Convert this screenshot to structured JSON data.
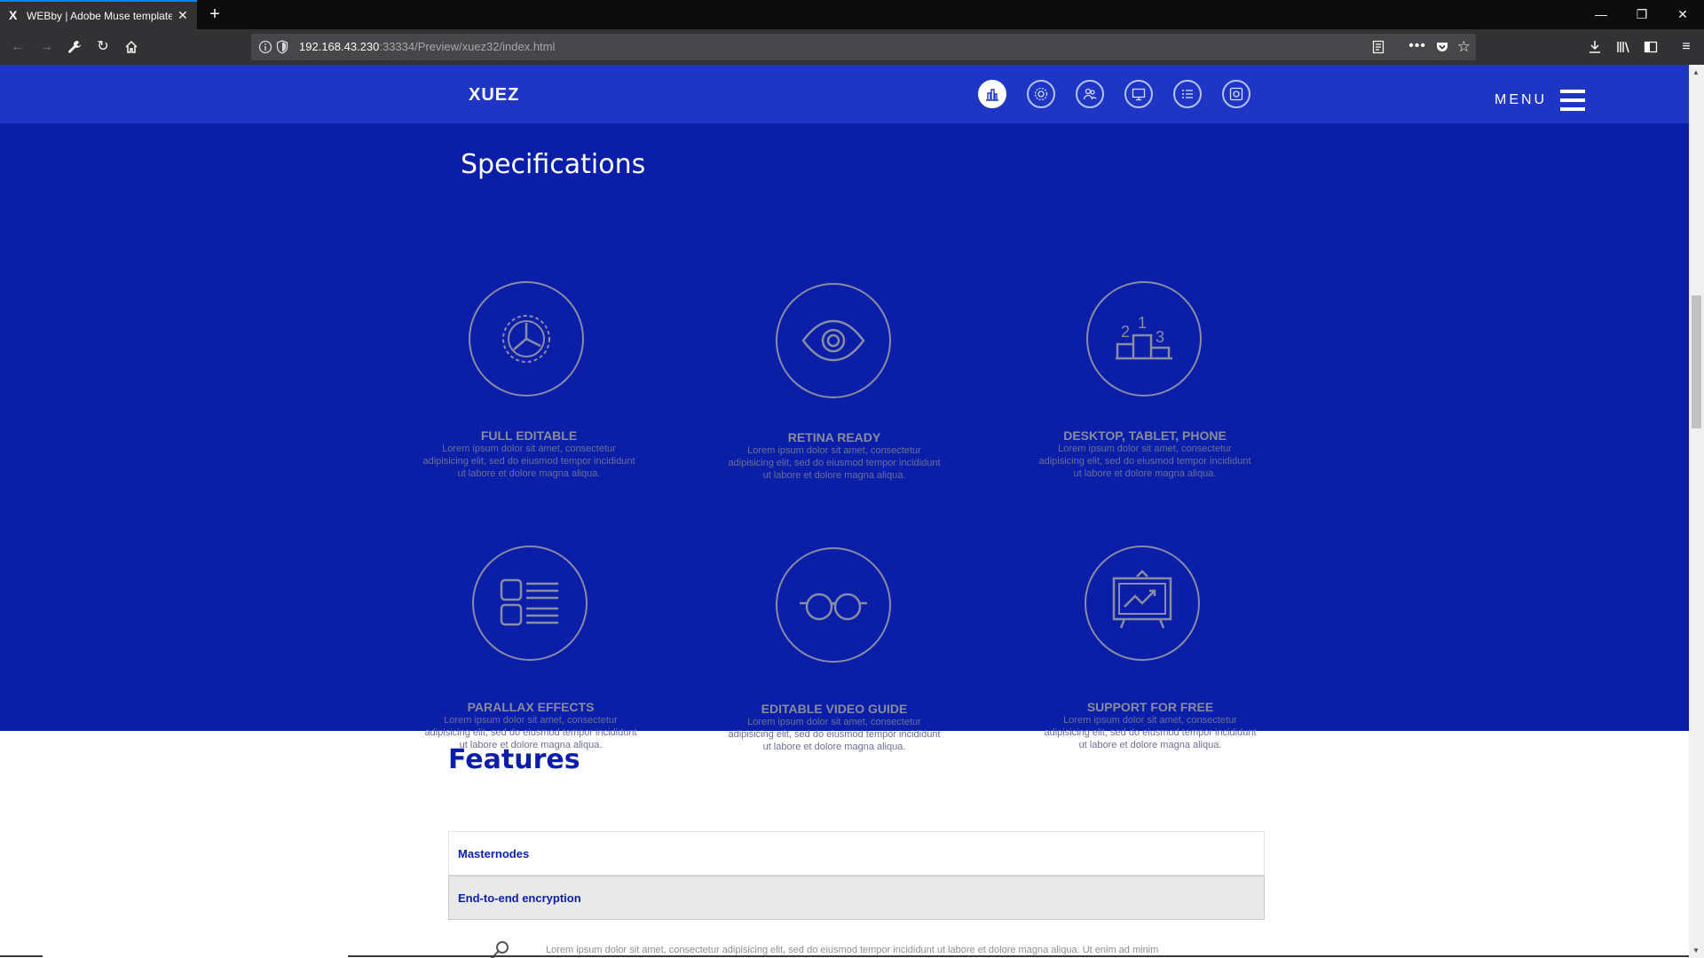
{
  "browser": {
    "tab_title": "WEBby | Adobe Muse template",
    "tab_favicon": "X",
    "url_host": "192.168.43.230",
    "url_path": ":33334/Preview/xuez32/index.html"
  },
  "header": {
    "logo": "XUEZ",
    "menu_label": "MENU",
    "icons": [
      "city-icon",
      "gear-icon",
      "users-icon",
      "monitor-icon",
      "list-icon",
      "settings-box-icon"
    ]
  },
  "specifications": {
    "title": "Specifications",
    "items": [
      {
        "title": "FULL EDITABLE",
        "desc": "Lorem ipsum dolor sit amet, consectetur adipisicing elit, sed do eiusmod tempor incididunt ut labore et dolore magna aliqua.",
        "icon": "gear-icon"
      },
      {
        "title": "RETINA READY",
        "desc": "Lorem ipsum dolor sit amet, consectetur adipisicing elit, sed do eiusmod tempor incididunt ut labore et dolore magna aliqua.",
        "icon": "eye-icon"
      },
      {
        "title": "DESKTOP, TABLET, PHONE",
        "desc": "Lorem ipsum dolor sit amet, consectetur adipisicing elit, sed do eiusmod tempor incididunt ut labore et dolore magna aliqua.",
        "icon": "podium-icon"
      },
      {
        "title": "PARALLAX EFFECTS",
        "desc": "Lorem ipsum dolor sit amet, consectetur adipisicing elit, sed do eiusmod tempor incididunt ut labore et dolore magna aliqua.",
        "icon": "list-icon"
      },
      {
        "title": "EDITABLE VIDEO GUIDE",
        "desc": "Lorem ipsum dolor sit amet, consectetur adipisicing elit, sed do eiusmod tempor incididunt ut labore et dolore magna aliqua.",
        "icon": "glasses-icon"
      },
      {
        "title": "SUPPORT FOR FREE",
        "desc": "Lorem ipsum dolor sit amet, consectetur adipisicing elit, sed do eiusmod tempor incididunt ut labore et dolore magna aliqua.",
        "icon": "presentation-icon"
      }
    ]
  },
  "features": {
    "title": "Features",
    "accordion": [
      {
        "label": "Masternodes",
        "open": false
      },
      {
        "label": "End-to-end encryption",
        "open": true
      }
    ],
    "open_text": "Lorem ipsum dolor sit amet, consectetur adipisicing elit, sed do eiusmod tempor incididunt ut labore et dolore magna aliqua. Ut enim ad minim"
  },
  "colors": {
    "header_bg": "#1f36c4",
    "specs_bg": "#0a1ea8",
    "accent": "#0a1ea8"
  }
}
